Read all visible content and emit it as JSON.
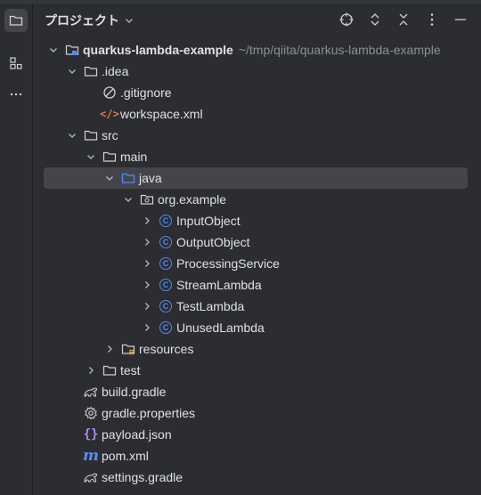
{
  "panel": {
    "title": "プロジェクト",
    "tools": [
      "crosshair-icon",
      "expand-icon",
      "collapse-icon",
      "more-icon",
      "hide-icon"
    ]
  },
  "tree": [
    {
      "label": "quarkus-lambda-example",
      "path": "~/tmp/qiita/quarkus-lambda-example",
      "depth": 0,
      "chevron": "down",
      "icon": "module-folder-icon",
      "bold": true
    },
    {
      "label": ".idea",
      "depth": 1,
      "chevron": "down",
      "icon": "folder-icon"
    },
    {
      "label": ".gitignore",
      "depth": 2,
      "chevron": "none",
      "icon": "ignored-file-icon"
    },
    {
      "label": "workspace.xml",
      "depth": 2,
      "chevron": "none",
      "icon": "xml-file-icon"
    },
    {
      "label": "src",
      "depth": 1,
      "chevron": "down",
      "icon": "folder-icon"
    },
    {
      "label": "main",
      "depth": 2,
      "chevron": "down",
      "icon": "folder-icon"
    },
    {
      "label": "java",
      "depth": 3,
      "chevron": "down",
      "icon": "source-folder-icon",
      "selected": true
    },
    {
      "label": "org.example",
      "depth": 4,
      "chevron": "down",
      "icon": "package-icon"
    },
    {
      "label": "InputObject",
      "depth": 5,
      "chevron": "right",
      "icon": "class-icon"
    },
    {
      "label": "OutputObject",
      "depth": 5,
      "chevron": "right",
      "icon": "class-icon"
    },
    {
      "label": "ProcessingService",
      "depth": 5,
      "chevron": "right",
      "icon": "class-icon"
    },
    {
      "label": "StreamLambda",
      "depth": 5,
      "chevron": "right",
      "icon": "class-icon"
    },
    {
      "label": "TestLambda",
      "depth": 5,
      "chevron": "right",
      "icon": "class-icon"
    },
    {
      "label": "UnusedLambda",
      "depth": 5,
      "chevron": "right",
      "icon": "class-icon"
    },
    {
      "label": "resources",
      "depth": 3,
      "chevron": "right",
      "icon": "resources-folder-icon"
    },
    {
      "label": "test",
      "depth": 2,
      "chevron": "right",
      "icon": "folder-icon"
    },
    {
      "label": "build.gradle",
      "depth": 1,
      "chevron": "none",
      "icon": "gradle-icon"
    },
    {
      "label": "gradle.properties",
      "depth": 1,
      "chevron": "none",
      "icon": "properties-icon"
    },
    {
      "label": "payload.json",
      "depth": 1,
      "chevron": "none",
      "icon": "json-file-icon"
    },
    {
      "label": "pom.xml",
      "depth": 1,
      "chevron": "none",
      "icon": "maven-icon"
    },
    {
      "label": "settings.gradle",
      "depth": 1,
      "chevron": "none",
      "icon": "gradle-icon"
    }
  ],
  "colors": {
    "background": "#2b2d30",
    "selection": "#43454a",
    "class_icon": "#548af7",
    "xml_icon": "#e8754a",
    "path_text": "#8c8f94"
  }
}
